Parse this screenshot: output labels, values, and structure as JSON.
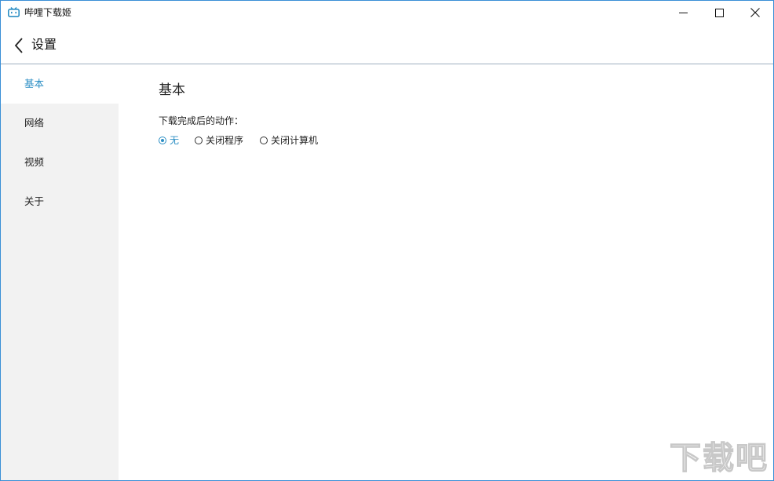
{
  "window": {
    "title": "哔哩下载姬",
    "app_icon": "bilibili-tv-icon",
    "controls": [
      "minimize-icon",
      "maximize-icon",
      "close-icon"
    ]
  },
  "header": {
    "back_icon": "chevron-left-icon",
    "title": "设置"
  },
  "sidebar": {
    "items": [
      {
        "label": "基本",
        "active": true
      },
      {
        "label": "网络",
        "active": false
      },
      {
        "label": "视频",
        "active": false
      },
      {
        "label": "关于",
        "active": false
      }
    ]
  },
  "content": {
    "title": "基本",
    "field_label": "下载完成后的动作：",
    "options": [
      {
        "label": "无",
        "checked": true
      },
      {
        "label": "关闭程序",
        "checked": false
      },
      {
        "label": "关闭计算机",
        "checked": false
      }
    ]
  },
  "colors": {
    "accent": "#2b8ec4",
    "sidebar_bg": "#f2f2f2",
    "window_border": "#3a8fd6"
  },
  "watermark": {
    "text": "下载吧"
  }
}
